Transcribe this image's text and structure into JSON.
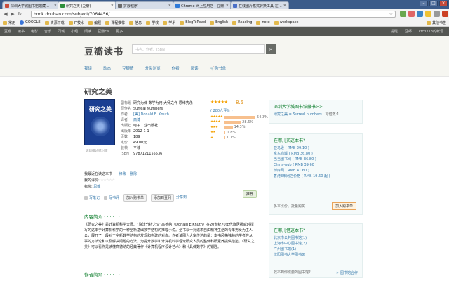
{
  "browser": {
    "tabs": [
      {
        "label": "深圳大学城图书馆馆藏…",
        "color": "#c94b3b"
      },
      {
        "label": "研究之美 (豆瓣)",
        "color": "#2f8f3b"
      },
      {
        "label": "扩展程序",
        "color": "#6b6b6b"
      },
      {
        "label": "Chrome 网上应用店 - 豆瓣…",
        "color": "#2f7ad8"
      },
      {
        "label": "在线图片格式转换工具-在…",
        "color": "#4a6fc7"
      }
    ],
    "url": "book.douban.com/subject/7064456/",
    "bookmarks": [
      "常用",
      "GOOGLE",
      "资源下载",
      "IT技术",
      "编程",
      "课程推荐",
      "信息",
      "学校",
      "学术",
      "BlogToRead",
      "English",
      "Reading",
      "note",
      "workspace"
    ],
    "other_bookmarks": "其他书签"
  },
  "topnav": {
    "items": [
      "豆瓣",
      "读书",
      "电影",
      "音乐",
      "同城",
      "小组",
      "阅读",
      "豆瓣FM",
      "更多"
    ],
    "right": [
      "提醒",
      "豆邮",
      "kfc3718的帐号"
    ]
  },
  "header": {
    "logo": "豆瓣读书",
    "search_placeholder": "书名、作者、ISBN",
    "subnav": [
      "我读",
      "动态",
      "豆瓣猜",
      "分类浏览",
      "作者",
      "阅读",
      "购书单"
    ]
  },
  "book": {
    "title": "研究之美",
    "cover_text": "研究之美",
    "cover_link": "更新描述或封面",
    "info": [
      {
        "k": "副标题",
        "v": "研究为体 数学为用 大师之作 思维隽永",
        "link": false
      },
      {
        "k": "原作名",
        "v": "Surreal Numbers",
        "link": false
      },
      {
        "k": "作者",
        "v": "[美] Donald E. Knuth",
        "link": true
      },
      {
        "k": "译者",
        "v": "高博",
        "link": true
      },
      {
        "k": "出版社",
        "v": "电子工业出版社",
        "link": false
      },
      {
        "k": "出版年",
        "v": "2012-1-1",
        "link": false
      },
      {
        "k": "页数",
        "v": "189",
        "link": false
      },
      {
        "k": "定价",
        "v": "49.00元",
        "link": false
      },
      {
        "k": "装帧",
        "v": "平装",
        "link": false
      },
      {
        "k": "ISBN",
        "v": "9787121155536",
        "link": false
      }
    ],
    "rating": {
      "stars": "★★★★★",
      "score": "8.5",
      "count": "( 280人评价 )",
      "distribution": [
        {
          "stars": "★★★★★",
          "pct": 54.3,
          "label": "54.3%"
        },
        {
          "stars": "★★★★",
          "pct": 28.6,
          "label": "28.6%"
        },
        {
          "stars": "★★★",
          "pct": 14.3,
          "label": "14.3%"
        },
        {
          "stars": "★★",
          "pct": 1.8,
          "label": "1.8%"
        },
        {
          "stars": "★",
          "pct": 1.1,
          "label": "1.1%"
        }
      ]
    },
    "wanted": "我最近在读这本书",
    "modify": "修改",
    "delete": "删除",
    "my_rating_label": "我的评价:",
    "my_stars": "☆☆☆☆☆",
    "tags_label": "标签:",
    "tags_value": "思维",
    "actions": [
      "写笔记",
      "写书评",
      "加入购书单",
      "添加到豆列"
    ],
    "share": "分享到",
    "recommend": "推荐",
    "intro_head": "内容简介 · · · · · ·",
    "intro_text": "《研究之美》是计算机科学大师、“算法分析之父”高德纳（Donald E.Knuth）在20世纪70年代旅居挪威时撰写的这本于计算机科学的一种全新基础数学结构的推理小说。全书以一对追求自由精神生活的青年男女为主人公，展开了一段对于全新数学结构的发现和构建的对白。作者试图为大家传达的是：本书风格独特的学者在从事的方法论和以及解决问题的方法，为提升数学和计算机科学理论研究人员的整体科研素养提供借鉴。《研究之美》可以看作是读懂高德纳的经典著作《计算机程序设计艺术》和《具体数学》的钥匙。",
    "author_head": "作者简介 · · · · · ·"
  },
  "sidebar": {
    "library": {
      "title": "深圳大学城图书馆藏书>>",
      "item": "研究之美 = Surreal numbers",
      "status": "可借数:1"
    },
    "buy": {
      "title": "在哪儿买这本书?",
      "items": [
        "亚马逊 ( RMB 29.10 )",
        "京东商城 ( RMB 36.80 )",
        "当当图书网 ( RMB 36.80 )",
        "China-pub ( RMB 39.60 )",
        "博库网 ( RMB 41.60 )",
        "香港E果网店价格 ( RMB 19.60 起 )"
      ],
      "more": "多本比价，批量购买",
      "buy_button": "加入购书单"
    },
    "borrow": {
      "title": "在哪儿借这本书?",
      "items": [
        "北京市公共图书馆(1)",
        "上海市中心图书馆(2)",
        "广州图书馆(1)",
        "沈阳图书大学图书馆"
      ],
      "footer": "找不到你需要的图书馆?",
      "footer_link": "> 图书馆合作"
    }
  }
}
